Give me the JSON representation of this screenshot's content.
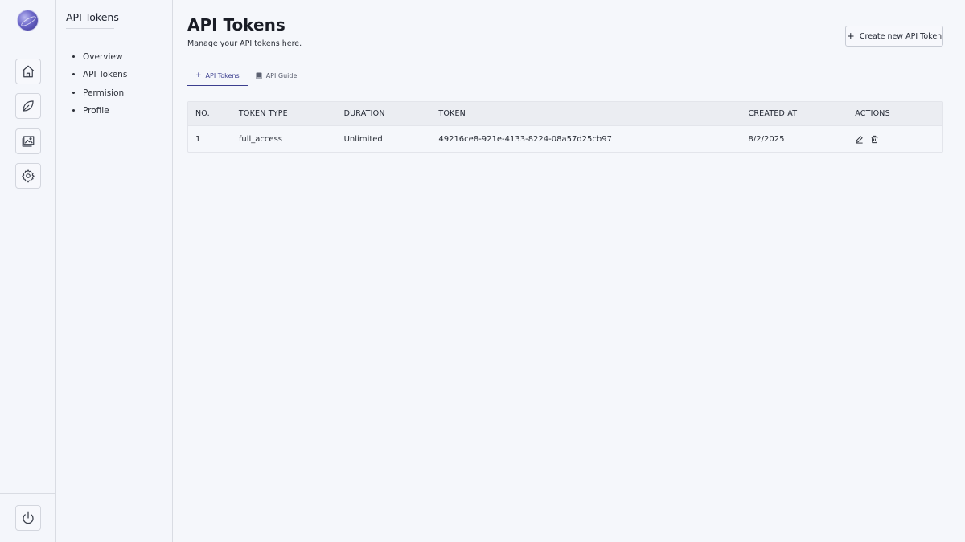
{
  "sidebar": {
    "title": "API Tokens",
    "items": [
      {
        "label": "Overview"
      },
      {
        "label": "API Tokens"
      },
      {
        "label": "Permision"
      },
      {
        "label": "Profile"
      }
    ]
  },
  "rail": {
    "icons": [
      "home-icon",
      "leaf-icon",
      "gallery-icon",
      "gear-icon",
      "power-icon"
    ]
  },
  "header": {
    "title": "API Tokens",
    "subtitle": "Manage your API tokens here.",
    "create_label": "Create new API Token"
  },
  "tabs": [
    {
      "label": "API Tokens",
      "icon": "plus-icon",
      "active": true
    },
    {
      "label": "API Guide",
      "icon": "book-icon",
      "active": false
    }
  ],
  "table": {
    "columns": [
      "NO.",
      "TOKEN TYPE",
      "DURATION",
      "TOKEN",
      "CREATED AT",
      "ACTIONS"
    ],
    "rows": [
      {
        "no": "1",
        "token_type": "full_access",
        "duration": "Unlimited",
        "token": "49216ce8-921e-4133-8224-08a57d25cb97",
        "created_at": "8/2/2025"
      }
    ]
  },
  "colors": {
    "accent": "#3c3f8f",
    "background": "#f5f7fb",
    "header_row": "#ebedf2"
  }
}
